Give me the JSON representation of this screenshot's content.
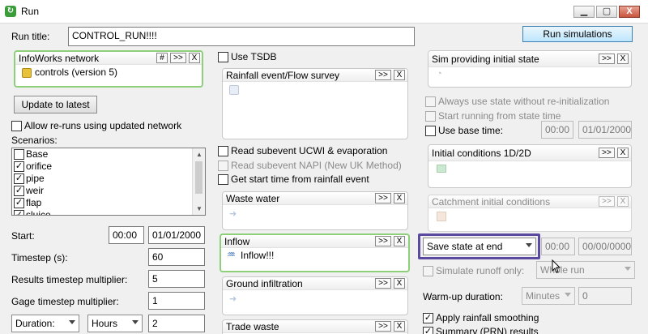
{
  "window": {
    "title": "Run",
    "minimize": "▁",
    "maximize": "▢",
    "close": "X"
  },
  "run_title": {
    "label": "Run title:",
    "value": "CONTROL_RUN!!!!"
  },
  "run_simulations_button": "Run simulations",
  "network_panel": {
    "title": "InfoWorks network",
    "hash": "#",
    "more": ">>",
    "clear": "X",
    "item": "controls (version 5)"
  },
  "update_button": "Update to latest",
  "allow_reruns": "Allow re-runs using updated network",
  "scenarios": {
    "label": "Scenarios:",
    "items": [
      {
        "label": "Base",
        "checked": false
      },
      {
        "label": "orifice",
        "checked": true
      },
      {
        "label": "pipe",
        "checked": true
      },
      {
        "label": "weir",
        "checked": true
      },
      {
        "label": "flap",
        "checked": true
      },
      {
        "label": "sluice",
        "checked": true
      }
    ]
  },
  "start": {
    "label": "Start:",
    "time": "00:00",
    "date": "01/01/2000"
  },
  "timestep": {
    "label": "Timestep (s):",
    "value": "60"
  },
  "results_multiplier": {
    "label": "Results timestep multiplier:",
    "value": "5"
  },
  "gage_multiplier": {
    "label": "Gage timestep multiplier:",
    "value": "1"
  },
  "duration": {
    "type": "Duration:",
    "unit": "Hours",
    "value": "2"
  },
  "use_tsdb": "Use TSDB",
  "rainfall_panel": {
    "title": "Rainfall event/Flow survey",
    "more": ">>",
    "clear": "X"
  },
  "read_ucwi": "Read subevent UCWI & evaporation",
  "read_napi": "Read subevent NAPI (New UK Method)",
  "get_start_time": "Get start time from rainfall event",
  "waste_water_panel": {
    "title": "Waste water",
    "more": ">>",
    "clear": "X"
  },
  "inflow_panel": {
    "title": "Inflow",
    "more": ">>",
    "clear": "X",
    "item": "Inflow!!!"
  },
  "ground_infiltration_panel": {
    "title": "Ground infiltration",
    "more": ">>",
    "clear": "X"
  },
  "trade_waste_panel": {
    "title": "Trade waste",
    "more": ">>",
    "clear": "X"
  },
  "initial_state_panel": {
    "title": "Sim providing initial state",
    "more": ">>",
    "clear": "X"
  },
  "always_use_state": "Always use state without re-initialization",
  "start_running_state": "Start running from state time",
  "use_base_time": {
    "label": "Use base time:",
    "time": "00:00",
    "date": "01/01/2000"
  },
  "initial_conditions_panel": {
    "title": "Initial conditions 1D/2D",
    "more": ">>",
    "clear": "X"
  },
  "catchment_panel": {
    "title": "Catchment initial conditions",
    "more": ">>",
    "clear": "X"
  },
  "save_state": {
    "value": "Save state at end",
    "time": "00:00",
    "date": "00/00/0000"
  },
  "simulate_runoff": {
    "label": "Simulate runoff only:",
    "value": "Whole run"
  },
  "warmup": {
    "label": "Warm-up duration:",
    "unit": "Minutes",
    "value": "0"
  },
  "apply_rainfall_smoothing": "Apply rainfall smoothing",
  "summary_results": "Summary (PRN) results",
  "colors": {
    "highlight": "#5b4aa0",
    "green_border": "#8ed07a",
    "primary_button": "#bee6fd"
  }
}
